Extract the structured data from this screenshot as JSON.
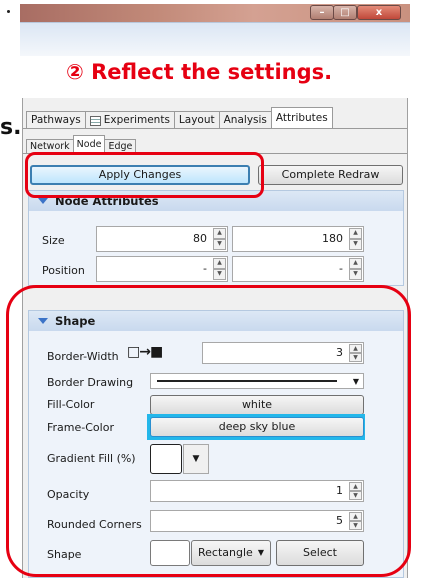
{
  "window": {
    "minimize_glyph": "–",
    "maximize_glyph": "□",
    "close_glyph": "x"
  },
  "callout": {
    "text": "② Reflect the settings.",
    "left_char": "s."
  },
  "tabs": {
    "main": [
      "Pathways",
      "Experiments",
      "Layout",
      "Analysis",
      "Attributes"
    ],
    "sub": [
      "Network",
      "Node",
      "Edge"
    ]
  },
  "buttons": {
    "apply": "Apply Changes",
    "redraw": "Complete Redraw"
  },
  "node_attributes": {
    "title": "Node Attributes",
    "size_label": "Size",
    "size_w": "80",
    "size_h": "180",
    "position_label": "Position",
    "position_x": "-",
    "position_y": "-"
  },
  "shape": {
    "title": "Shape",
    "border_width_label": "Border-Width",
    "border_width_icon": "□→■",
    "border_width_value": "3",
    "border_drawing_label": "Border Drawing",
    "fill_color_label": "Fill-Color",
    "fill_color_value": "white",
    "frame_color_label": "Frame-Color",
    "frame_color_value": "deep sky blue",
    "gradient_label": "Gradient Fill (%)",
    "opacity_label": "Opacity",
    "opacity_value": "1",
    "rounded_label": "Rounded Corners",
    "rounded_value": "5",
    "shape_label": "Shape",
    "shape_value": "Rectangle",
    "select_label": "Select"
  },
  "colors": {
    "callout_red": "#e60012",
    "accent_blue": "#23b7ea"
  }
}
